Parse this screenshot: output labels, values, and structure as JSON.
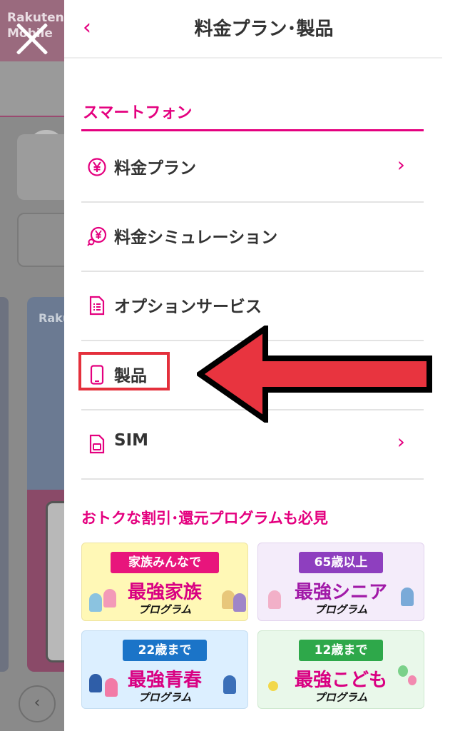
{
  "background": {
    "logo_line1": "Rakuten",
    "logo_line2": "Mobile",
    "tile_logo": "Rakuten",
    "back_glyph": "‹"
  },
  "drawer": {
    "title": "料金プラン･製品",
    "back_glyph": "‹"
  },
  "section": {
    "title": "スマートフォン"
  },
  "menu": [
    {
      "label": "料金プラン",
      "icon": "yen-icon",
      "chevron": "›"
    },
    {
      "label": "料金シミュレーション",
      "icon": "yen-search-icon",
      "chevron": ""
    },
    {
      "label": "オプションサービス",
      "icon": "document-icon",
      "chevron": ""
    },
    {
      "label": "製品",
      "icon": "smartphone-icon",
      "chevron": "›"
    },
    {
      "label": "SIM",
      "icon": "sim-icon",
      "chevron": "›"
    }
  ],
  "promo_heading": "おトクな割引･還元プログラムも必見",
  "promos": [
    {
      "tag": "家族みんなで",
      "main": "最強家族",
      "sub": "プログラム"
    },
    {
      "tag": "65歳以上",
      "main": "最強シニア",
      "sub": "プログラム"
    },
    {
      "tag": "22歳まで",
      "main": "最強青春",
      "sub": "プログラム"
    },
    {
      "tag": "12歳まで",
      "main": "最強こども",
      "sub": "プログラム"
    }
  ],
  "colors": {
    "accent": "#e4007f",
    "highlight": "#e4303c"
  }
}
